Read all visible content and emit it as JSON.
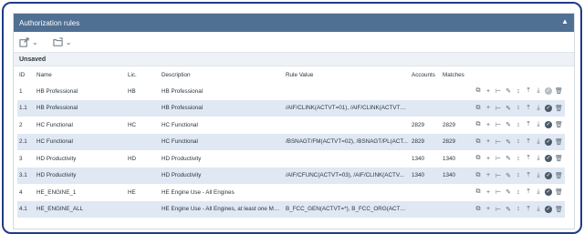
{
  "panel": {
    "title": "Authorization rules",
    "section": "Unsaved"
  },
  "columns": {
    "id": "ID",
    "name": "Name",
    "lic": "Lic.",
    "description": "Description",
    "rule_value": "Rule Value",
    "accounts": "Accounts",
    "matches": "Matches"
  },
  "rows": [
    {
      "id": "1",
      "name": "HB Professional",
      "lic": "HB",
      "description": "HB Professional",
      "rule_value": "",
      "accounts": "",
      "matches": "",
      "status": "grey"
    },
    {
      "id": "1.1",
      "name": "HB Professional",
      "lic": "",
      "description": "HB Professional",
      "rule_value": "/AIF/CLINK(ACTVT=01), /AIF/CLINK(ACTVT=...",
      "accounts": "",
      "matches": "",
      "status": "dark"
    },
    {
      "id": "2",
      "name": "HC Functional",
      "lic": "HC",
      "description": "HC Functional",
      "rule_value": "",
      "accounts": "2829",
      "matches": "2829",
      "status": "dark"
    },
    {
      "id": "2.1",
      "name": "HC Functional",
      "lic": "",
      "description": "HC Functional",
      "rule_value": "/BSNAGT/FM(ACTVT=02), /BSNAGT/PL(ACT...",
      "accounts": "2829",
      "matches": "2829",
      "status": "dark"
    },
    {
      "id": "3",
      "name": "HD Productivity",
      "lic": "HD",
      "description": "HD Productivity",
      "rule_value": "",
      "accounts": "1340",
      "matches": "1340",
      "status": "dark"
    },
    {
      "id": "3.1",
      "name": "HD Productivity",
      "lic": "",
      "description": "HD Productivity",
      "rule_value": "/AIF/CFUNC(ACTVT=03), /AIF/CLINK(ACTV...",
      "accounts": "1340",
      "matches": "1340",
      "status": "dark"
    },
    {
      "id": "4",
      "name": "HE_ENGINE_1",
      "lic": "HE",
      "description": "HE Engine Use - All Engines",
      "rule_value": "",
      "accounts": "",
      "matches": "",
      "status": "dark"
    },
    {
      "id": "4.1",
      "name": "HE_ENGINE_ALL",
      "lic": "",
      "description": "HE Engine Use - All Engines, at least one Match",
      "rule_value": "B_FCC_GEN(ACTVT=*), B_FCC_ORG(ACTVT=*...",
      "accounts": "",
      "matches": "",
      "status": "dark"
    }
  ]
}
